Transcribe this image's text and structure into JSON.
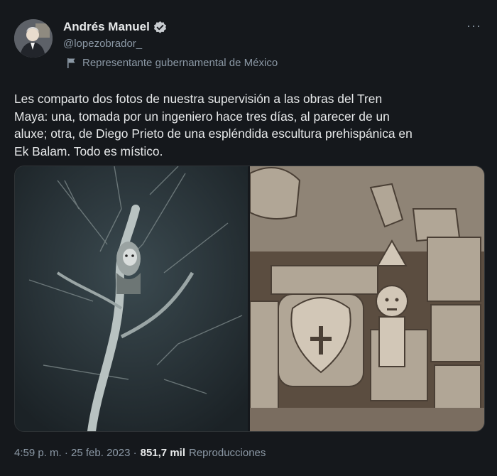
{
  "author": {
    "name": "Andrés Manuel",
    "handle": "@lopezobrador_",
    "label": "Representante gubernamental de México"
  },
  "tweet": {
    "text": "Les comparto dos fotos de nuestra supervisión a las obras del Tren\nMaya: una, tomada por un ingeniero hace tres días, al parecer de un\naluxe; otra, de Diego Prieto de una espléndida escultura prehispánica en\nEk Balam. Todo es místico.",
    "time": "4:59 p. m. · 25 feb. 2023 ·",
    "views": "851,7 mil",
    "views_label": "Reproducciones"
  },
  "menu": {
    "more_label": "···"
  },
  "colors": {
    "background": "#15181c",
    "text": "#e7e9ea",
    "secondary": "#8b98a5",
    "verified_badge": "#c8ccd0"
  },
  "icons": [
    "verified-icon",
    "government-flag-icon",
    "more-options-icon"
  ]
}
